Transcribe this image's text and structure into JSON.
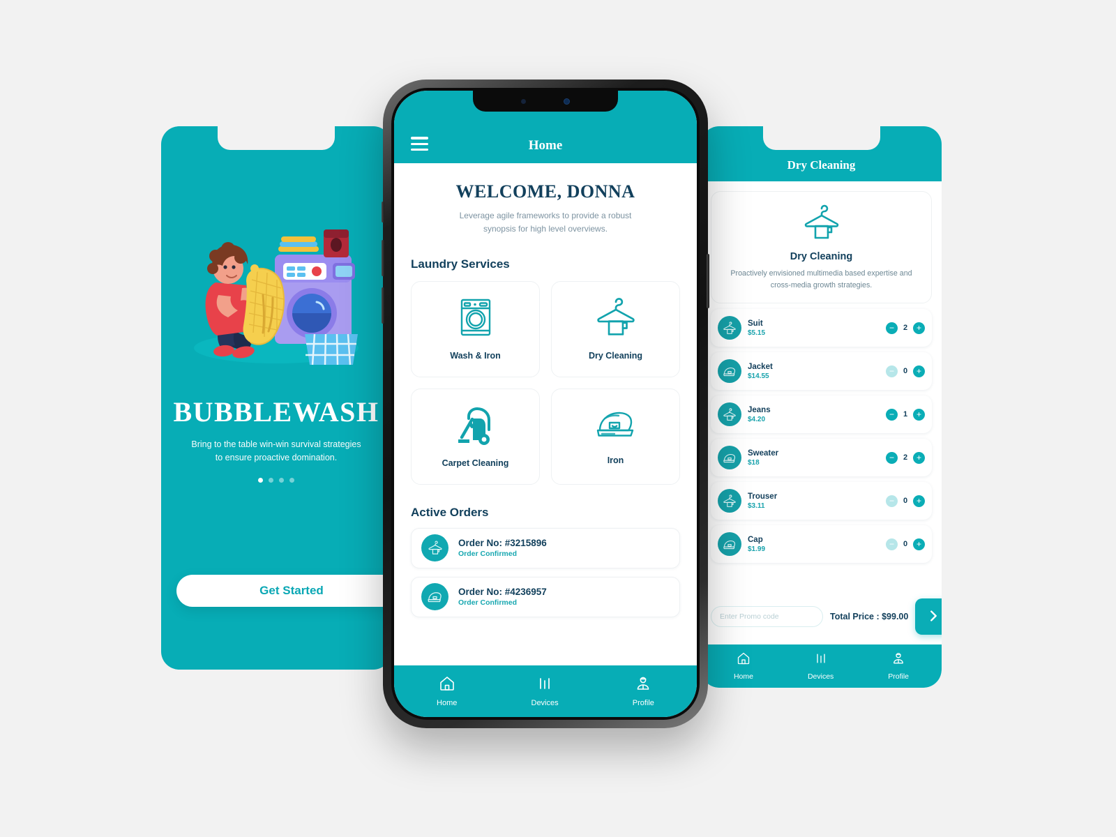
{
  "brand": {
    "accent": "#07adb6",
    "dark_text": "#12405c",
    "page_bg": "#f2f2f2"
  },
  "onboarding": {
    "illustration_icon": "woman-with-laundry-illustration",
    "title": "BUBBLEWASH",
    "subtitle": "Bring to the table win-win survival strategies to ensure proactive domination.",
    "dots_total": 4,
    "dot_active_index": 0,
    "cta_label": "Get Started"
  },
  "home": {
    "header": {
      "menu_icon": "hamburger-menu-icon",
      "title": "Home"
    },
    "welcome_title": "WELCOME, DONNA",
    "welcome_subtitle": "Leverage agile frameworks to provide a robust synopsis for high level overviews.",
    "services_title": "Laundry Services",
    "services": [
      {
        "label": "Wash & Iron",
        "icon": "washing-machine-icon"
      },
      {
        "label": "Dry Cleaning",
        "icon": "hanger-shirt-icon"
      },
      {
        "label": "Carpet Cleaning",
        "icon": "vacuum-cleaner-icon"
      },
      {
        "label": "Iron",
        "icon": "clothes-iron-icon"
      }
    ],
    "orders_title": "Active Orders",
    "orders": [
      {
        "number": "Order No: #3215896",
        "status": "Order Confirmed",
        "icon": "hanger-shirt-icon"
      },
      {
        "number": "Order No: #4236957",
        "status": "Order Confirmed",
        "icon": "clothes-iron-icon"
      }
    ],
    "nav": [
      {
        "label": "Home",
        "icon": "home-icon",
        "active": true
      },
      {
        "label": "Devices",
        "icon": "devices-bars-icon",
        "active": false
      },
      {
        "label": "Profile",
        "icon": "profile-person-icon",
        "active": false
      }
    ]
  },
  "dry_cleaning": {
    "header_title": "Dry Cleaning",
    "hero": {
      "icon": "hanger-shirt-icon",
      "name": "Dry Cleaning",
      "description": "Proactively envisioned multimedia based expertise and cross-media growth strategies."
    },
    "items": [
      {
        "name": "Suit",
        "price": "$5.15",
        "qty": "2",
        "icon": "hanger-shirt-icon",
        "minus_disabled": false
      },
      {
        "name": "Jacket",
        "price": "$14.55",
        "qty": "0",
        "icon": "clothes-iron-icon",
        "minus_disabled": true
      },
      {
        "name": "Jeans",
        "price": "$4.20",
        "qty": "1",
        "icon": "hanger-shirt-icon",
        "minus_disabled": false
      },
      {
        "name": "Sweater",
        "price": "$18",
        "qty": "2",
        "icon": "clothes-iron-icon",
        "minus_disabled": false
      },
      {
        "name": "Trouser",
        "price": "$3.11",
        "qty": "0",
        "icon": "hanger-shirt-icon",
        "minus_disabled": true
      },
      {
        "name": "Cap",
        "price": "$1.99",
        "qty": "0",
        "icon": "clothes-iron-icon",
        "minus_disabled": true
      }
    ],
    "promo_placeholder": "Enter Promo code",
    "promo_value": "",
    "total_price": "Total Price : $99.00",
    "submit_icon": "chevron-right-icon",
    "nav": [
      {
        "label": "Home",
        "icon": "home-icon",
        "active": true
      },
      {
        "label": "Devices",
        "icon": "devices-bars-icon",
        "active": false
      },
      {
        "label": "Profile",
        "icon": "profile-person-icon",
        "active": false
      }
    ]
  }
}
